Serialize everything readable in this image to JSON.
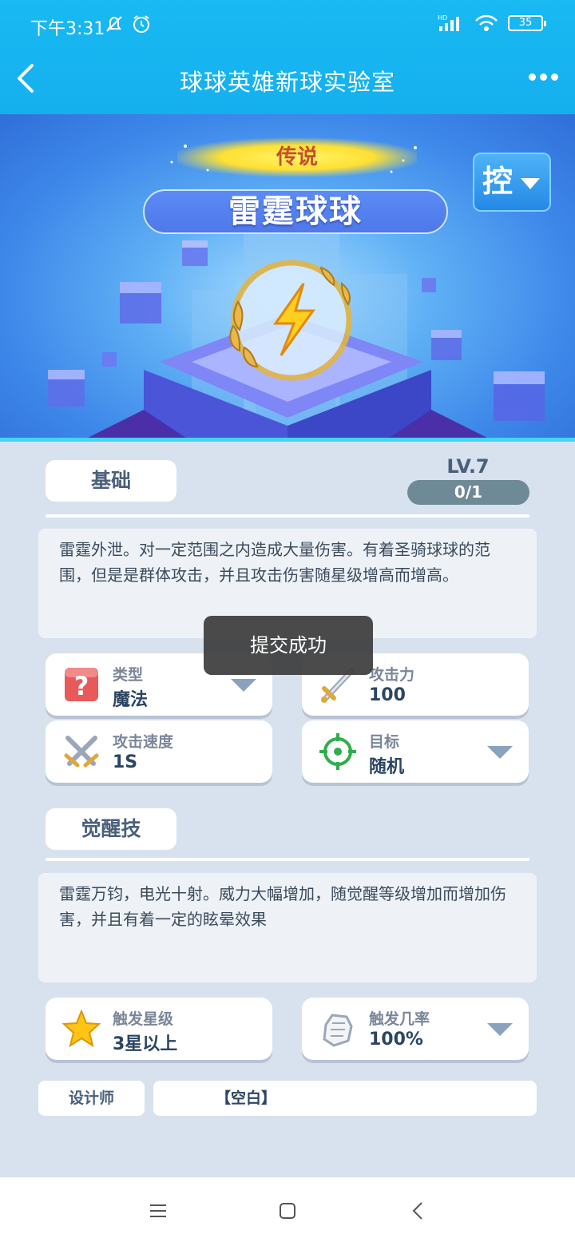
{
  "status": {
    "time": "下午3:31",
    "battery": "35",
    "net": "HD"
  },
  "header": {
    "title": "球球英雄新球实验室"
  },
  "hero": {
    "rarity": "传说",
    "name": "雷霆球球",
    "control_label": "控"
  },
  "basic": {
    "section_label": "基础",
    "level": "LV.7",
    "progress": "0/1",
    "description": "雷霆外泄。对一定范围之内造成大量伤害。有着圣骑球球的范围，但是是群体攻击，并且攻击伤害随星级增高而增高。",
    "stats": [
      {
        "key": "类型",
        "value": "魔法"
      },
      {
        "key": "攻击力",
        "value": "100"
      },
      {
        "key": "攻击速度",
        "value": "1S"
      },
      {
        "key": "目标",
        "value": "随机"
      }
    ]
  },
  "awaken": {
    "section_label": "觉醒技",
    "description": "雷霆万钧，电光十射。威力大幅增加，随觉醒等级增加而增加伤害，并且有着一定的眩晕效果",
    "stats": [
      {
        "key": "触发星级",
        "value": "3星以上"
      },
      {
        "key": "触发几率",
        "value": "100%"
      }
    ]
  },
  "designer": {
    "label": "设计师",
    "value": "【空白】"
  },
  "toast": {
    "text": "提交成功"
  },
  "colors": {
    "topbar": "#14b0ee",
    "page_bg": "#d8e2ee",
    "accent_cyan": "#3fd7f4"
  }
}
